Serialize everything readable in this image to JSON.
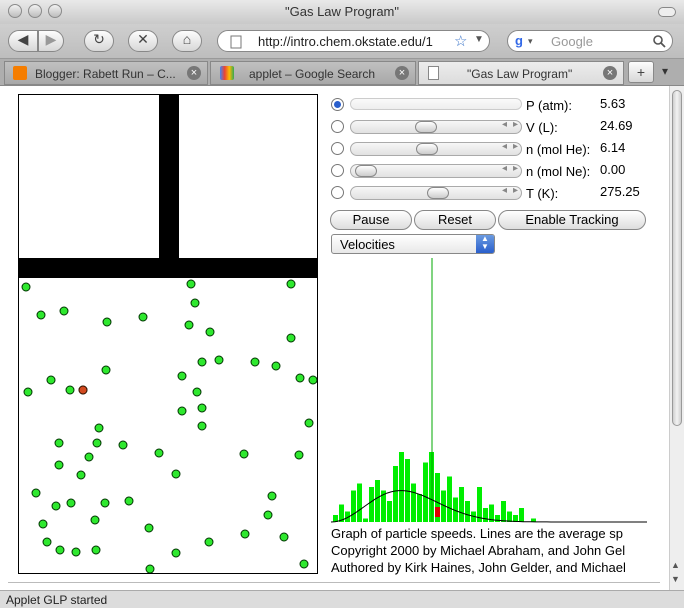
{
  "window": {
    "title": "\"Gas Law Program\""
  },
  "toolbar": {
    "url": "http://intro.chem.okstate.edu/1",
    "search_placeholder": "Google"
  },
  "tabs": [
    {
      "label": "Blogger: Rabett Run – C..."
    },
    {
      "label": "applet – Google Search"
    },
    {
      "label": "\"Gas Law Program\""
    }
  ],
  "controls": {
    "rows": [
      {
        "label": "P (atm):",
        "value": "5.63",
        "selected": true
      },
      {
        "label": "V (L):",
        "value": "24.69",
        "level": 0.44
      },
      {
        "label": "n (mol He):",
        "value": "6.14",
        "level": 0.45
      },
      {
        "label": "n (mol Ne):",
        "value": "0.00",
        "level": 0.0
      },
      {
        "label": "T (K):",
        "value": "275.25",
        "level": 0.53
      }
    ],
    "pause_label": "Pause",
    "reset_label": "Reset",
    "tracking_label": "Enable Tracking",
    "graph_select": "Velocities"
  },
  "histogram": {
    "colors": {
      "bar": "#00ee00",
      "highlight": "#e00000",
      "line": "#00aa00",
      "curve": "#000000"
    },
    "bars": [
      2,
      5,
      3,
      9,
      11,
      1,
      10,
      12,
      9,
      6,
      16,
      20,
      18,
      11,
      8,
      17,
      20,
      14,
      9,
      13,
      7,
      10,
      6,
      3,
      10,
      4,
      5,
      2,
      6,
      3,
      2,
      4,
      0,
      1,
      0,
      0,
      0,
      0
    ],
    "highlight_index": 17,
    "mean_index": 16
  },
  "credits": [
    "Graph of particle speeds.  Lines are the average sp",
    "Copyright 2000 by Michael Abraham, and John Gel",
    "Authored by Kirk Haines, John Gelder, and Michael"
  ],
  "status": {
    "text": "Applet GLP started"
  }
}
